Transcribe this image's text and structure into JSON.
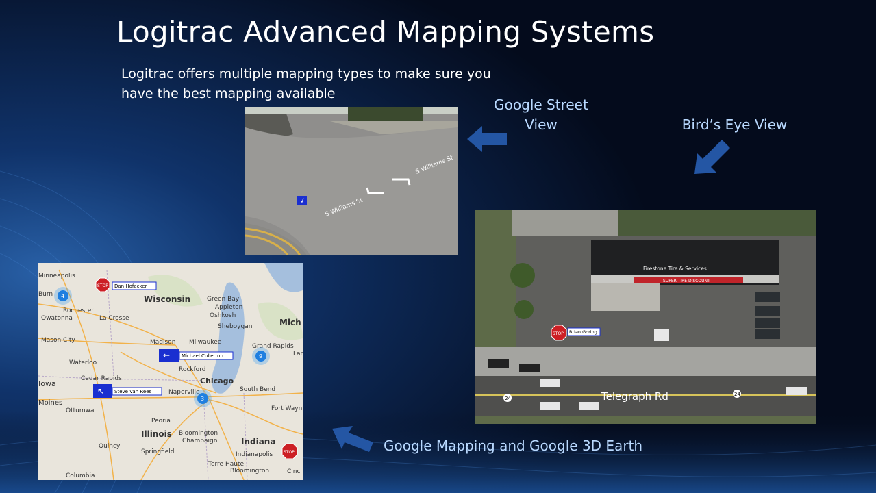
{
  "slide": {
    "title": "Logitrac Advanced Mapping Systems",
    "subtitle": "Logitrac offers multiple mapping types to make sure you have the best mapping available"
  },
  "captions": {
    "street_view_line1": "Google Street",
    "street_view_line2": "View",
    "birds_eye": "Bird’s Eye View",
    "google_mapping": "Google Mapping and Google 3D Earth"
  },
  "street_view": {
    "street_label_1": "S Williams St",
    "street_label_2": "S Williams St"
  },
  "birds_eye_view": {
    "business_sign": "Firestone Tire & Services",
    "store_banner": "SUPER TIRE DISCOUNT",
    "road_name": "Telegraph Rd",
    "route_shield": "24",
    "driver_label": "Brian Goring",
    "stop_sign": "STOP"
  },
  "map": {
    "cities": [
      "Minneapolis",
      "Wisconsin",
      "Green Bay",
      "Appleton",
      "Oshkosh",
      "Rochester",
      "La Crosse",
      "Owatonna",
      "Sheboygan",
      "Mason City",
      "Madison",
      "Milwaukee",
      "Grand Rapids",
      "Waterloo",
      "Rockford",
      "Cedar Rapids",
      "Chicago",
      "Iowa",
      "South Bend",
      "Moines",
      "Ottumwa",
      "Naperville",
      "Fort Wayne",
      "Peoria",
      "Illinois",
      "Bloomington",
      "Champaign",
      "Indiana",
      "Quincy",
      "Springfield",
      "Indianapolis",
      "Terre Haute",
      "Bloomington",
      "Columbia",
      "Cinc",
      "Mich",
      "Lans",
      "Burn"
    ],
    "drivers": [
      "Dan Hofacker",
      "Michael Cullerton",
      "Steve Van Rees"
    ],
    "clusters": [
      "4",
      "9",
      "3"
    ],
    "stop_sign": "STOP"
  }
}
